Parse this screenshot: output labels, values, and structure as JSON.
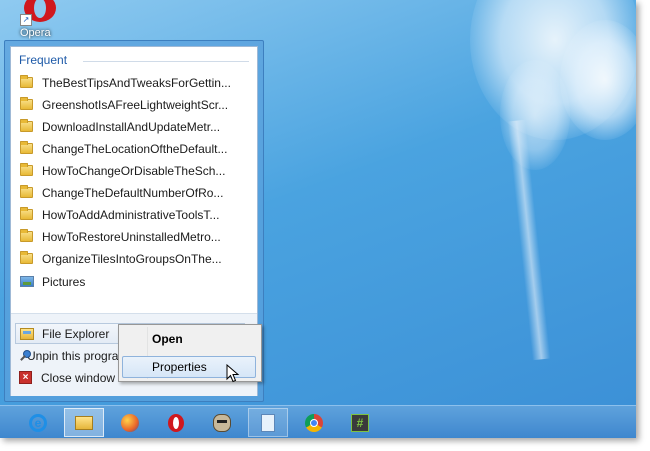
{
  "desktop": {
    "icons": [
      {
        "label": "Opera",
        "icon": "opera-icon"
      }
    ]
  },
  "jumplist": {
    "section_title": "Frequent",
    "items": [
      {
        "label": "TheBestTipsAndTweaksForGettin...",
        "icon": "folder-icon"
      },
      {
        "label": "GreenshotIsAFreeLightweightScr...",
        "icon": "folder-icon"
      },
      {
        "label": "DownloadInstallAndUpdateMetr...",
        "icon": "folder-icon"
      },
      {
        "label": "ChangeTheLocationOftheDefault...",
        "icon": "folder-icon"
      },
      {
        "label": "HowToChangeOrDisableTheSch...",
        "icon": "folder-icon"
      },
      {
        "label": "ChangeTheDefaultNumberOfRo...",
        "icon": "folder-icon"
      },
      {
        "label": "HowToAddAdministrativeToolsT...",
        "icon": "folder-icon"
      },
      {
        "label": "HowToRestoreUninstalledMetro...",
        "icon": "folder-icon"
      },
      {
        "label": "OrganizeTilesIntoGroupsOnThe...",
        "icon": "folder-icon"
      },
      {
        "label": "Pictures",
        "icon": "pictures-icon"
      }
    ],
    "tasks": [
      {
        "label": "File Explorer",
        "icon": "file-explorer-icon"
      },
      {
        "label": "Unpin this program from taskbar",
        "icon": "unpin-icon"
      },
      {
        "label": "Close window",
        "icon": "close-icon"
      }
    ]
  },
  "context_menu": {
    "items": [
      {
        "label": "Open",
        "bold": true
      },
      {
        "label": "Properties",
        "hover": true
      }
    ]
  },
  "taskbar": {
    "buttons": [
      {
        "app": "Internet Explorer",
        "icon": "internet-explorer-icon"
      },
      {
        "app": "File Explorer",
        "icon": "file-explorer-icon",
        "active": true
      },
      {
        "app": "Firefox",
        "icon": "firefox-icon"
      },
      {
        "app": "Opera",
        "icon": "opera-icon"
      },
      {
        "app": "GIMP",
        "icon": "gimp-icon"
      },
      {
        "app": "Notepad",
        "icon": "notepad-icon",
        "pinned": true
      },
      {
        "app": "Chrome",
        "icon": "chrome-icon"
      },
      {
        "app": "Greenshot",
        "icon": "greenshot-icon"
      }
    ]
  }
}
